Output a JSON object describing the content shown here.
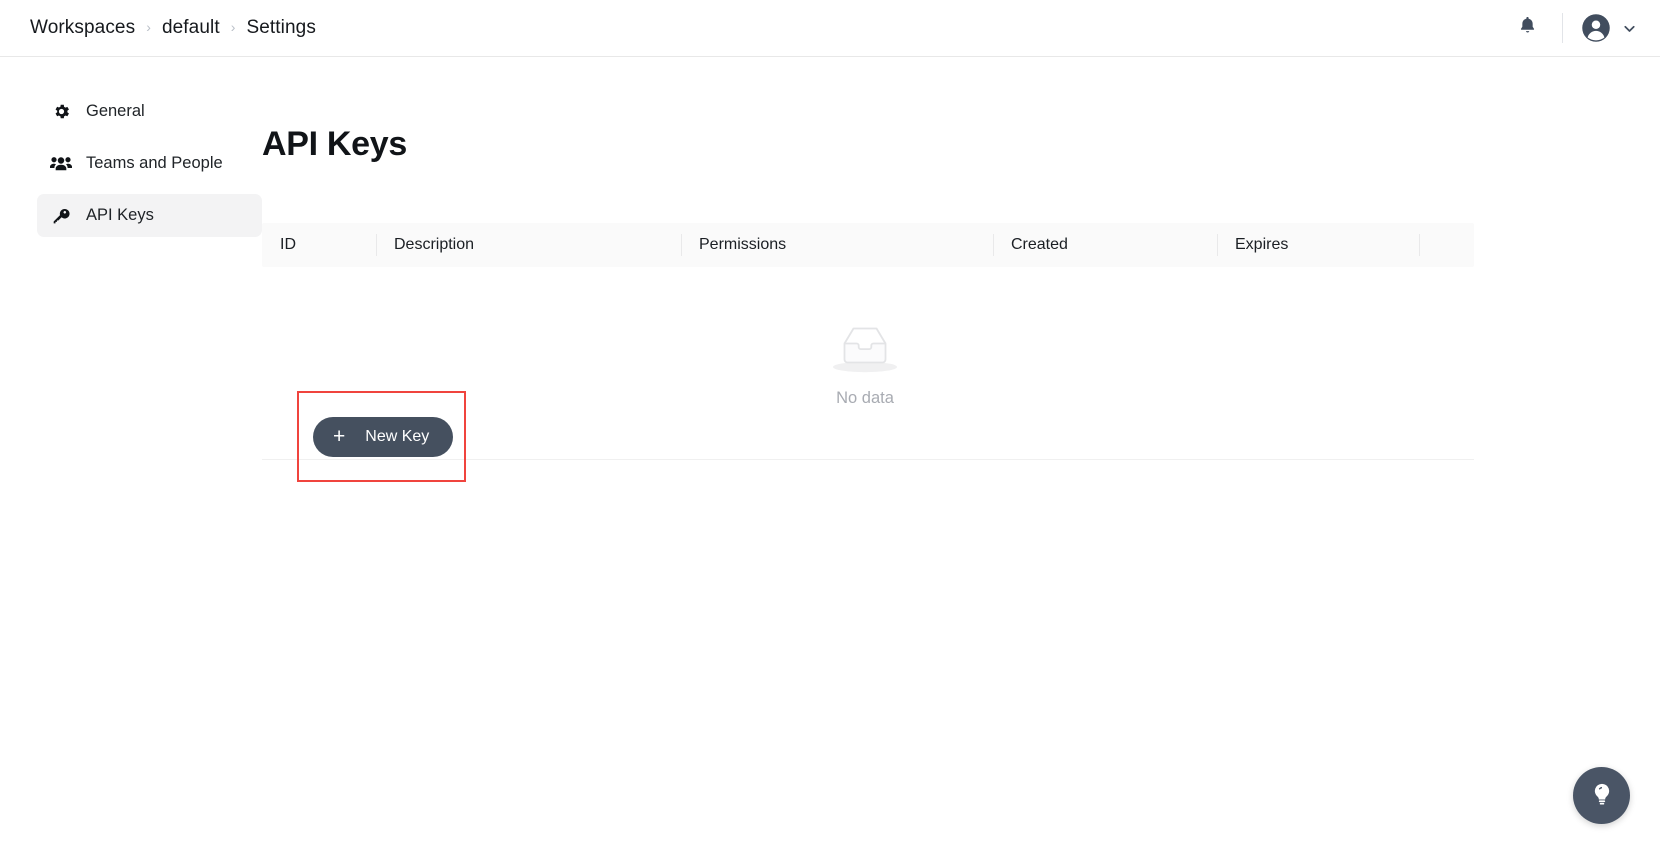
{
  "topbar": {
    "breadcrumb": [
      {
        "label": "Workspaces"
      },
      {
        "label": "default"
      },
      {
        "label": "Settings"
      }
    ],
    "separator": "›",
    "notifications_icon": "bell-icon",
    "account_icon": "user-avatar-icon",
    "account_chevron_icon": "chevron-down-icon"
  },
  "sidebar": {
    "items": [
      {
        "label": "General",
        "icon": "gear-icon",
        "active": false
      },
      {
        "label": "Teams and People",
        "icon": "people-icon",
        "active": false
      },
      {
        "label": "API Keys",
        "icon": "key-icon",
        "active": true
      }
    ]
  },
  "main": {
    "title": "API Keys",
    "table": {
      "columns": [
        "ID",
        "Description",
        "Permissions",
        "Created",
        "Expires",
        ""
      ],
      "rows": [],
      "empty_text": "No data",
      "empty_icon": "empty-inbox-icon"
    },
    "new_key_button": {
      "label": "New Key",
      "plus_icon": "plus-icon"
    }
  },
  "help_fab": {
    "icon": "lightbulb-icon"
  },
  "colors": {
    "accent_dark": "#45505f",
    "annotation_red": "#f0443e",
    "table_header_bg": "#fafafa",
    "sidebar_active_bg": "#f3f3f4",
    "muted_text": "#a8abb2"
  }
}
